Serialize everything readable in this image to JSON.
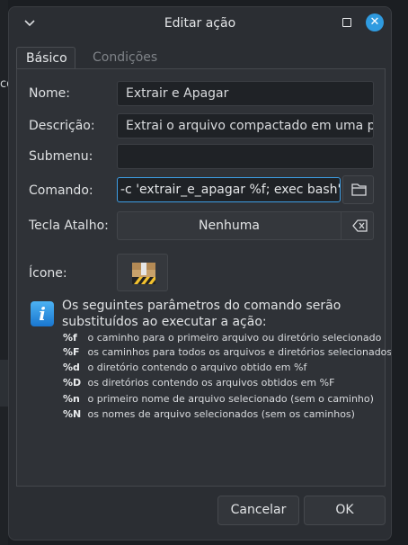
{
  "background": {
    "partial_text": "co"
  },
  "window": {
    "title": "Editar ação",
    "menu_icon": "chevron-down-icon",
    "close_icon": "close-icon",
    "accent": "#2f9be0"
  },
  "tabs": [
    {
      "label": "Básico",
      "active": true
    },
    {
      "label": "Condições para aparecer",
      "active": false
    }
  ],
  "form": {
    "name_label": "Nome:",
    "name_value": "Extrair e Apagar",
    "description_label": "Descrição:",
    "description_value": "Extrai o arquivo compactado em uma pa",
    "submenu_label": "Submenu:",
    "submenu_value": "",
    "command_label": "Comando:",
    "command_value": "-c 'extrair_e_apagar %f; exec bash'\"",
    "shortcut_label": "Tecla Atalho:",
    "shortcut_value": "Nenhuma",
    "icon_label": "Ícone:"
  },
  "info": {
    "heading": "Os seguintes parâmetros do comando serão substituídos ao executar a ação:",
    "params": [
      {
        "code": "%f",
        "desc": "o caminho para o primeiro arquivo ou diretório selecionado"
      },
      {
        "code": "%F",
        "desc": "os caminhos para todos os arquivos e diretórios selecionados"
      },
      {
        "code": "%d",
        "desc": "o diretório contendo o arquivo obtido em %f"
      },
      {
        "code": "%D",
        "desc": "os diretórios contendo os arquivos obtidos em %F"
      },
      {
        "code": "%n",
        "desc": "o primeiro nome de arquivo selecionado (sem o caminho)"
      },
      {
        "code": "%N",
        "desc": "os nomes de arquivo selecionados (sem os caminhos)"
      }
    ]
  },
  "buttons": {
    "cancel": "Cancelar",
    "ok": "OK"
  }
}
